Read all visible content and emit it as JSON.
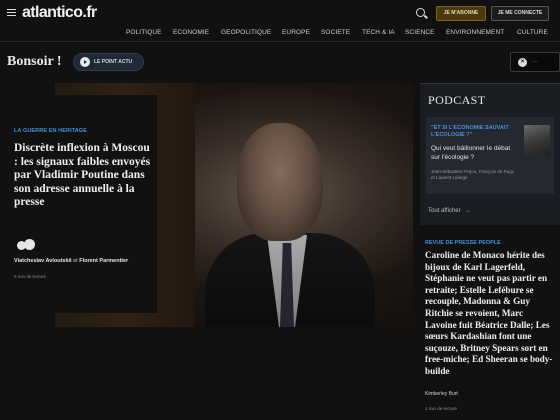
{
  "header": {
    "logo": "atlantico",
    "logo_tld": ".fr",
    "subscribe_label": "JE M'ABONNE",
    "login_label": "JE ME CONNECTE"
  },
  "nav": {
    "items": [
      {
        "label": "POLITIQUE"
      },
      {
        "label": "ECONOMIE"
      },
      {
        "label": "GEOPOLITIQUE"
      },
      {
        "label": "EUROPE"
      },
      {
        "label": "SOCIETE"
      },
      {
        "label": "TECH & IA"
      },
      {
        "label": "SCIENCE"
      },
      {
        "label": "ENVIRONNEMENT"
      },
      {
        "label": "CULTURE"
      }
    ]
  },
  "greeting": "Bonsoir !",
  "point_actu_label": "LE POINT ACTU",
  "close_label": "···",
  "hero": {
    "kicker": "LA GUERRE EN HERITAGE",
    "title": "Discrète inflexion à Moscou : les signaux faibles envoyés par Vladimir Poutine dans son adresse annuelle à la presse",
    "author1": "Viatcheslav Avioutskii",
    "author_sep": "et",
    "author2": "Florent Parmentier",
    "readtime": "5 min de lecture"
  },
  "podcast": {
    "title": "PODCAST",
    "card_kicker": "\"ET SI L'ECONOMIE SAUVAIT L'ECOLOGIE ?\"",
    "card_title": "Qui veut bâillonner le débat sur l'écologie ?",
    "card_guests": "Jean-Sébastien Ferjou, François de Rugy et Laurent Lelarge",
    "link_label": "Tout afficher",
    "link_arrow": "→"
  },
  "side_article": {
    "kicker": "REVUE DE PRESSE PEOPLE",
    "title": "Caroline de Monaco hérite des bijoux de Karl Lagerfeld, Stéphanie ne veut pas partir en retraite; Estelle Lefébure se recouple, Madonna & Guy Ritchie se revoient, Marc Lavoine fuit Béatrice Dalle; Les sœurs Kardashian font une suçouze, Britney Spears sort en free-miche; Ed Sheeran se body-builde",
    "author": "Kimberley Burt",
    "readtime": "1 min de lecture"
  },
  "colors": {
    "background": "#111111",
    "accent_blue": "#4c8fd6",
    "subscribe_bg": "#4a3a10",
    "podcast_bg": "#1a1d22"
  }
}
